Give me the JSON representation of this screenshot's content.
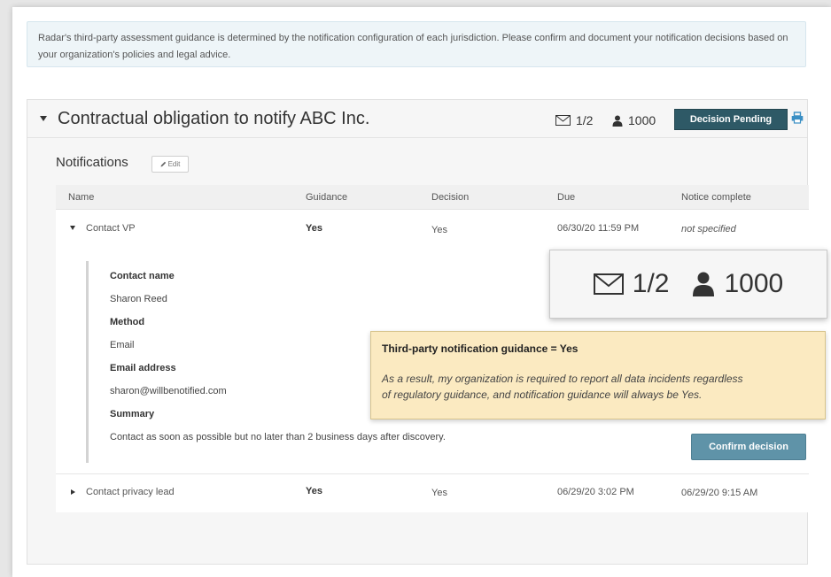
{
  "info": {
    "text": "Radar's third-party assessment guidance is determined by the notification configuration of each jurisdiction. Please confirm and document your notification decisions based on your organization's policies and legal advice."
  },
  "panel": {
    "title": "Contractual obligation to notify ABC Inc.",
    "notices": "1/2",
    "people": "1000",
    "status": "Decision Pending",
    "icons": {
      "mail": "mail-icon",
      "person": "person-icon",
      "print": "print-icon",
      "edit": "pencil-icon"
    }
  },
  "notifications": {
    "title": "Notifications",
    "edit_label": "Edit",
    "columns": [
      "Name",
      "Guidance",
      "Decision",
      "Due",
      "Notice complete"
    ],
    "rows": [
      {
        "name": "Contact VP",
        "guidance": "Yes",
        "decision": "Yes",
        "due": "06/30/20 11:59 PM",
        "complete": "not specified"
      },
      {
        "name": "Contact privacy lead",
        "guidance": "Yes",
        "decision": "Yes",
        "due": "06/29/20 3:02 PM",
        "complete": "06/29/20 9:15 AM"
      }
    ],
    "detail": {
      "contact_name_label": "Contact name",
      "contact_name": "Sharon Reed",
      "method_label": "Method",
      "method": "Email",
      "email_label": "Email address",
      "email": "sharon@willbenotified.com",
      "summary_label": "Summary",
      "summary": "Contact as soon as possible but no later than 2 business days after discovery."
    }
  },
  "confirm_label": "Confirm decision",
  "zoom": {
    "notices": "1/2",
    "people": "1000"
  },
  "tooltip": {
    "title": "Third-party notification guidance = Yes",
    "line1": "As a result, my organization is required to report all data incidents regardless",
    "line2": "of regulatory guidance, and notification guidance will always be Yes."
  },
  "colors": {
    "badge": "#2e5966",
    "confirm": "#5f93a8",
    "print": "#3a8fc4",
    "tooltip_bg": "#fbeac1",
    "info_bg": "#eef5f8"
  }
}
